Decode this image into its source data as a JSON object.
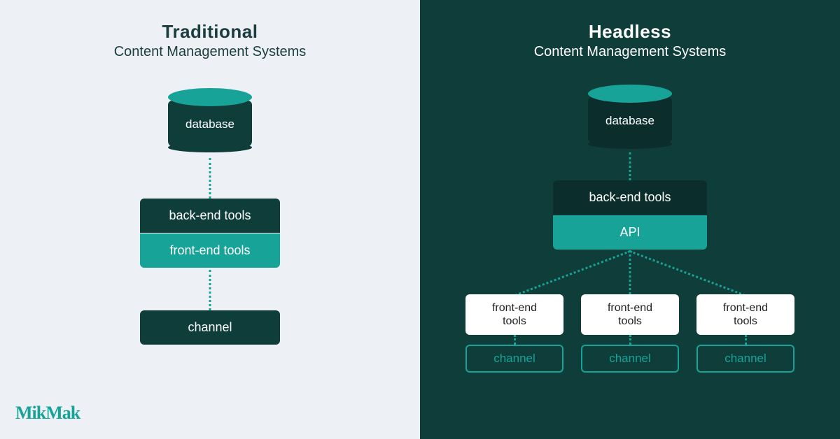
{
  "brand": {
    "logo_text": "MikMak"
  },
  "left": {
    "title": "Traditional",
    "subtitle": "Content Management Systems",
    "nodes": {
      "database": "database",
      "backend": "back-end tools",
      "frontend": "front-end tools",
      "channel": "channel"
    }
  },
  "right": {
    "title": "Headless",
    "subtitle": "Content Management Systems",
    "nodes": {
      "database": "database",
      "backend": "back-end tools",
      "api": "API",
      "frontend": "front-end tools",
      "channel": "channel"
    }
  }
}
